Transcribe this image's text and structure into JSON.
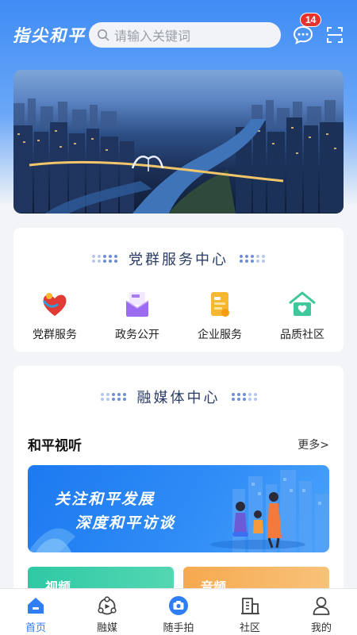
{
  "header": {
    "logo_text": "指尖和平",
    "search_placeholder": "请输入关键词",
    "message_badge": "14"
  },
  "party_services": {
    "title": "党群服务中心",
    "items": [
      {
        "label": "党群服务",
        "icon": "heart-figure-icon"
      },
      {
        "label": "政务公开",
        "icon": "news-envelope-icon"
      },
      {
        "label": "企业服务",
        "icon": "document-icon"
      },
      {
        "label": "品质社区",
        "icon": "home-heart-icon"
      }
    ]
  },
  "media_center": {
    "title": "融媒体中心",
    "section_title": "和平视听",
    "more_label": "更多>",
    "promo_line1": "关注和平发展",
    "promo_line2": "深度和平访谈",
    "mini_cards": [
      "视频",
      "音频"
    ]
  },
  "tabbar": {
    "items": [
      {
        "label": "首页",
        "icon": "home-icon",
        "active": true
      },
      {
        "label": "融媒",
        "icon": "media-icon",
        "active": false
      },
      {
        "label": "随手拍",
        "icon": "camera-icon",
        "active": false
      },
      {
        "label": "社区",
        "icon": "building-icon",
        "active": false
      },
      {
        "label": "我的",
        "icon": "user-icon",
        "active": false
      }
    ]
  },
  "colors": {
    "accent": "#2f7ef5",
    "header_blue": "#3f8cf5",
    "badge_red": "#e8322e",
    "title_navy": "#2b3d66"
  }
}
